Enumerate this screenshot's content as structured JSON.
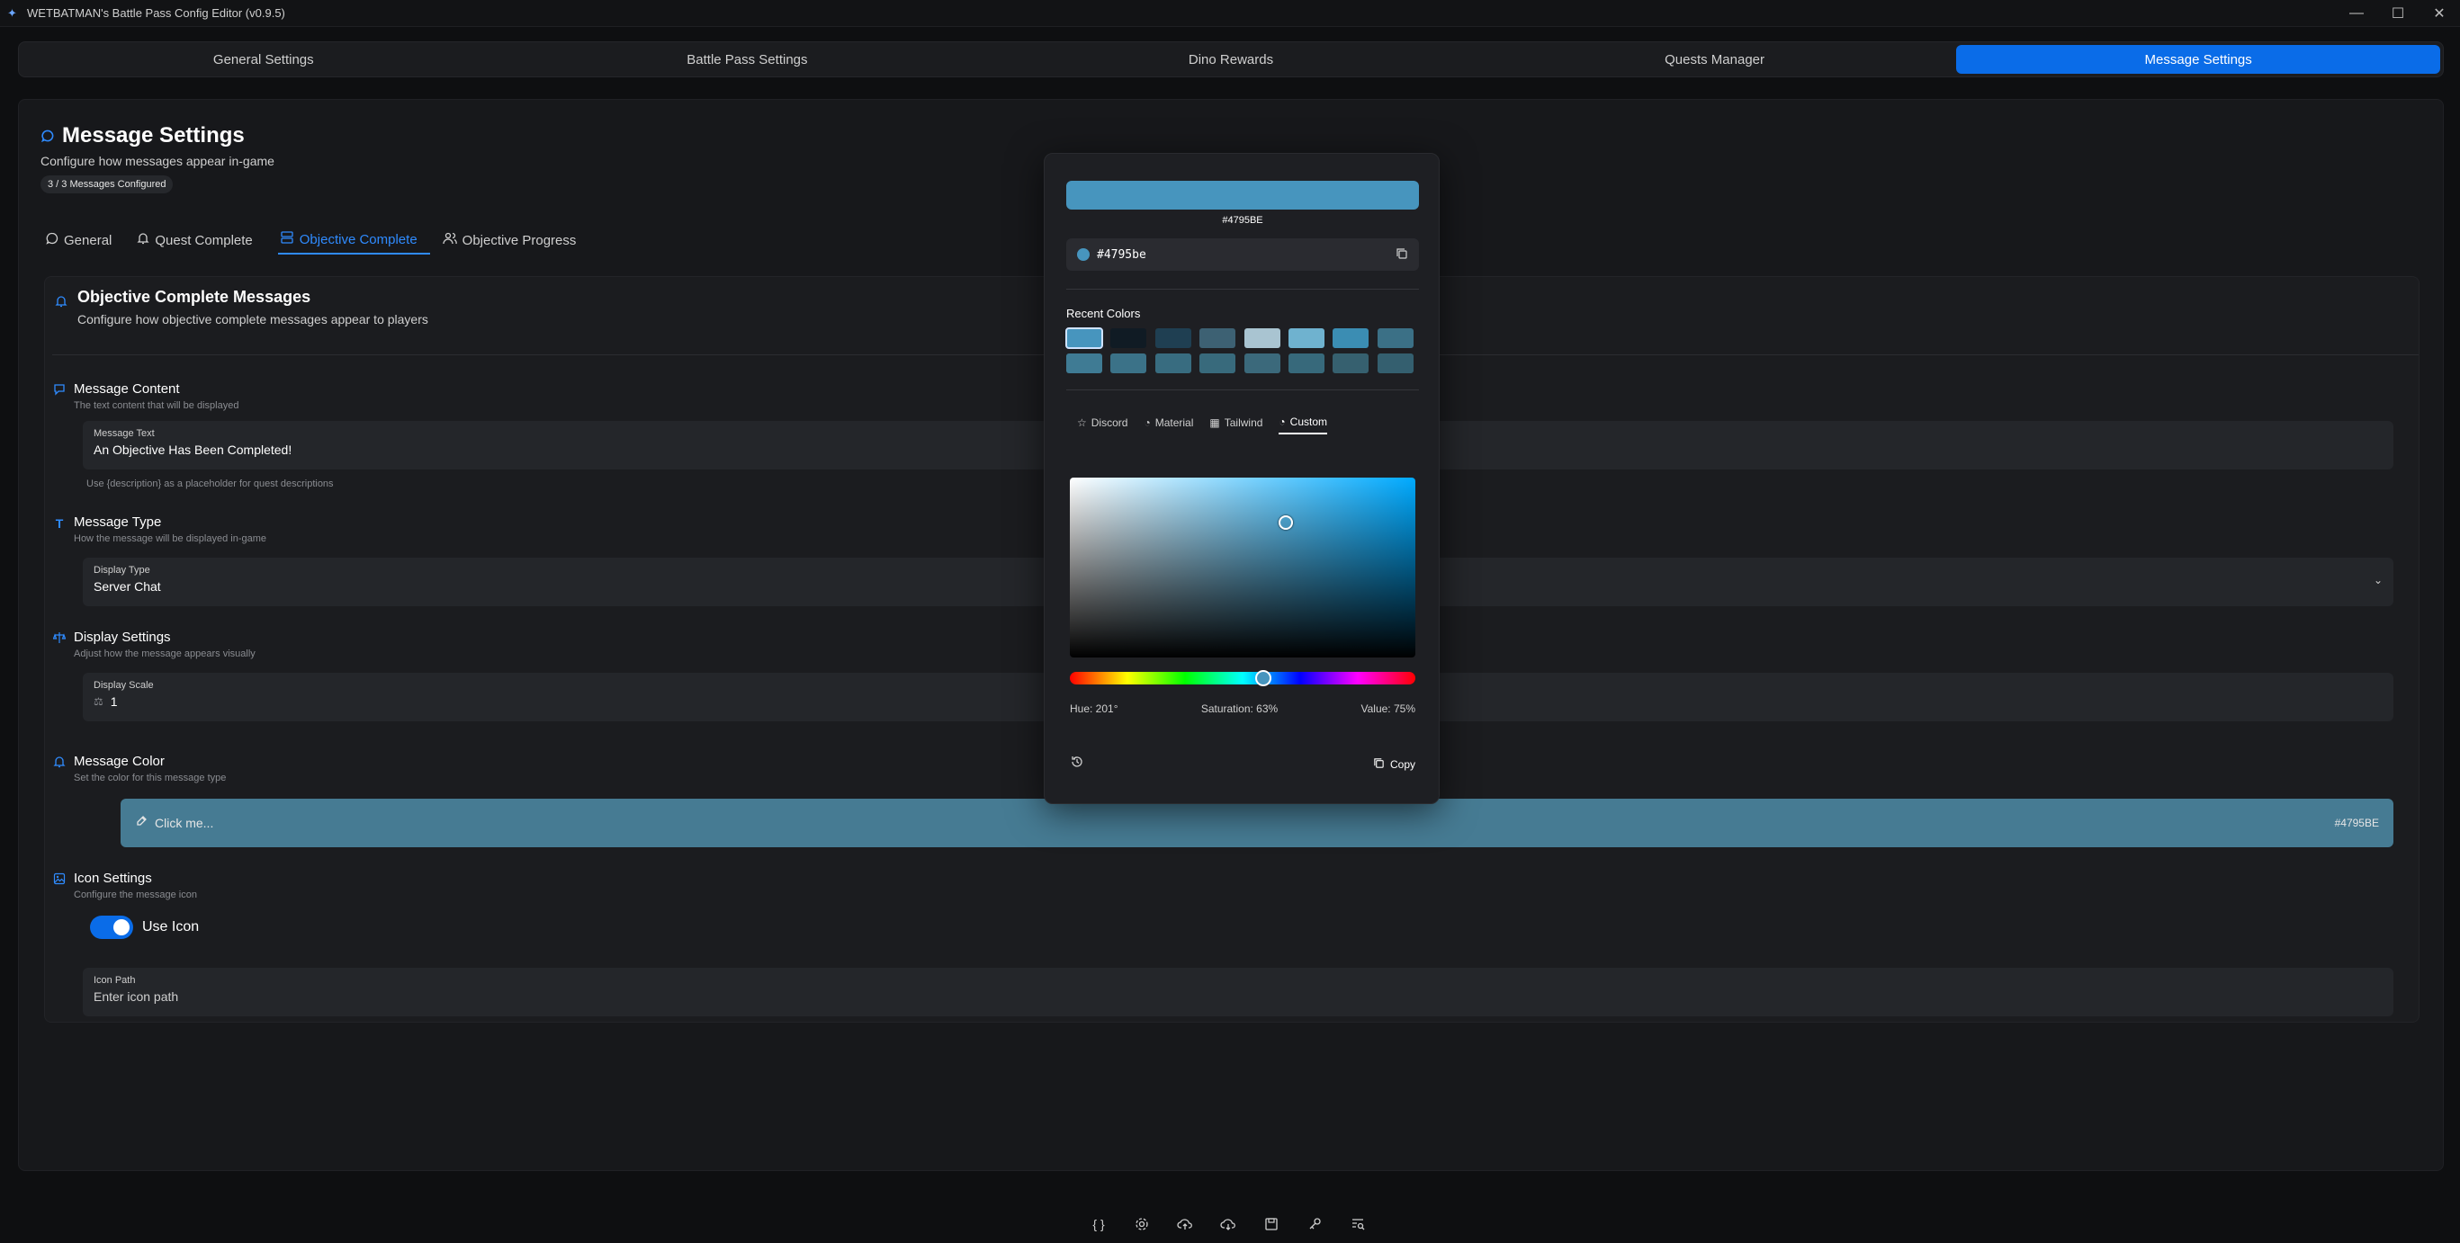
{
  "window": {
    "title": "WETBATMAN's Battle Pass Config Editor (v0.9.5)"
  },
  "mainnav": [
    {
      "label": "General Settings"
    },
    {
      "label": "Battle Pass Settings"
    },
    {
      "label": "Dino Rewards"
    },
    {
      "label": "Quests Manager"
    },
    {
      "label": "Message Settings",
      "active": true
    }
  ],
  "page": {
    "title": "Message Settings",
    "subtitle": "Configure how messages appear in-game",
    "badge": "3 / 3 Messages Configured"
  },
  "subtabs": [
    {
      "label": "General",
      "icon": "chat-icon"
    },
    {
      "label": "Quest Complete",
      "icon": "bell-icon"
    },
    {
      "label": "Objective Complete",
      "icon": "layers-icon",
      "active": true
    },
    {
      "label": "Objective Progress",
      "icon": "users-icon"
    }
  ],
  "section": {
    "title": "Objective Complete Messages",
    "subtitle": "Configure how objective complete messages appear to players"
  },
  "content": {
    "title": "Message Content",
    "subtitle": "The text content that will be displayed",
    "label": "Message Text",
    "value": "An Objective Has Been Completed!",
    "hint": "Use {description} as a placeholder for quest descriptions"
  },
  "type": {
    "title": "Message Type",
    "subtitle": "How the message will be displayed in-game",
    "label": "Display Type",
    "value": "Server Chat"
  },
  "display": {
    "title": "Display Settings",
    "subtitle": "Adjust how the message appears visually",
    "label": "Display Scale",
    "value": "1"
  },
  "color": {
    "title": "Message Color",
    "subtitle": "Set the color for this message type",
    "placeholder": "Click me...",
    "hex": "#4795BE",
    "value_hex": "#4795be"
  },
  "icon": {
    "title": "Icon Settings",
    "subtitle": "Configure the message icon",
    "toggle_label": "Use Icon",
    "toggle_on": true,
    "path_label": "Icon Path",
    "path_placeholder": "Enter icon path"
  },
  "picker": {
    "hex_upper": "#4795BE",
    "hex_lower": "#4795be",
    "recent_title": "Recent Colors",
    "recent_colors": [
      "#4795be",
      "#101b24",
      "#1f3f52",
      "#3d6173",
      "#a9c4d1",
      "#6fb2cf",
      "#3b8db3",
      "#3b7086",
      "#3f7b94",
      "#3b7288",
      "#386c80",
      "#386a7c",
      "#3b697b",
      "#37697b",
      "#36606f",
      "#345f6f"
    ],
    "tabs": [
      {
        "label": "Discord",
        "icon": "star-icon"
      },
      {
        "label": "Material",
        "icon": "palette-icon"
      },
      {
        "label": "Tailwind",
        "icon": "grid-icon"
      },
      {
        "label": "Custom",
        "icon": "palette-icon",
        "active": true
      }
    ],
    "hue": "Hue: 201°",
    "saturation": "Saturation: 63%",
    "value": "Value: 75%",
    "copy_label": "Copy"
  },
  "colors": {
    "accent": "#0a6ce8",
    "message_color": "#4795be"
  }
}
